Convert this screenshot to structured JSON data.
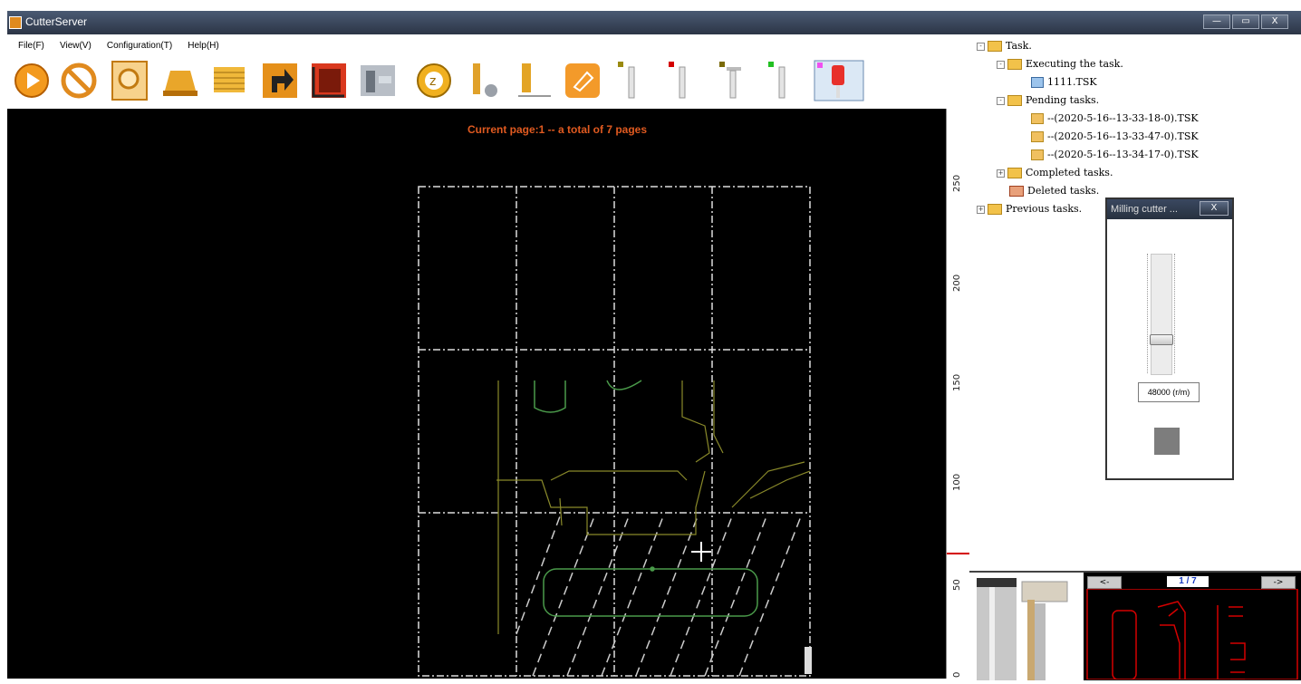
{
  "window": {
    "title": "CutterServer",
    "min": "—",
    "max": "▭",
    "close": "X"
  },
  "menu": [
    "File(F)",
    "View(V)",
    "Configuration(T)",
    "Help(H)"
  ],
  "canvas": {
    "status": "Current page:1 -- a total of 7 pages"
  },
  "ruler": {
    "labels": [
      "250",
      "200",
      "150",
      "100",
      "50",
      "0"
    ]
  },
  "tree": {
    "task": "Task.",
    "executing": "Executing the task.",
    "executing_file": "1111.TSK",
    "pending": "Pending tasks.",
    "pending_files": [
      "--(2020-5-16--13-33-18-0).TSK",
      "--(2020-5-16--13-33-47-0).TSK",
      "--(2020-5-16--13-34-17-0).TSK"
    ],
    "completed": "Completed tasks.",
    "deleted": "Deleted tasks.",
    "previous": "Previous tasks."
  },
  "dialog": {
    "title": "Milling cutter ...",
    "close": "X",
    "speed": "48000 (r/m)",
    "slider_fraction": 0.72
  },
  "preview": {
    "prev": "<-",
    "next": "->",
    "page": "1 / 7"
  },
  "colors": {
    "status_text": "#e05a20",
    "accent_red": "#d40000"
  }
}
